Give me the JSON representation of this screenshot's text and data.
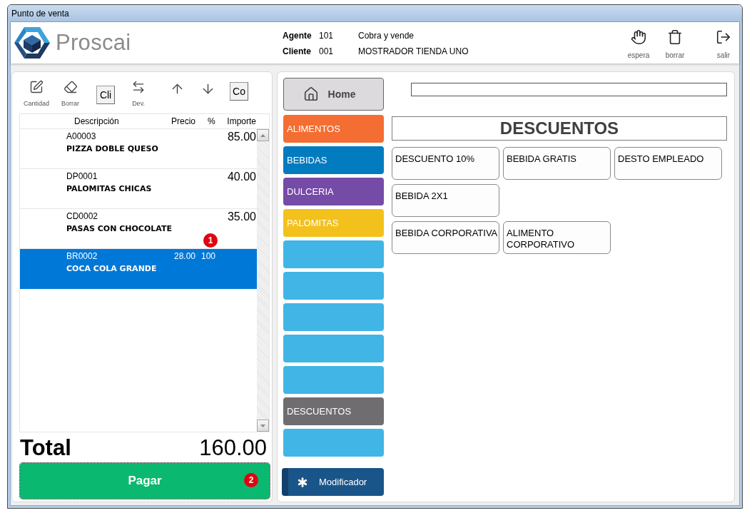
{
  "window": {
    "title": "Punto de venta"
  },
  "logo": {
    "text": "Proscai"
  },
  "session": [
    {
      "label": "Agente",
      "code": "101",
      "value": "Cobra y vende"
    },
    {
      "label": "Cliente",
      "code": "001",
      "value": "MOSTRADOR TIENDA UNO"
    }
  ],
  "header_actions": [
    {
      "label": "espera"
    },
    {
      "label": "borrar"
    },
    {
      "label": "salir"
    }
  ],
  "toolbar": [
    {
      "kind": "icon",
      "label": "Cantidad"
    },
    {
      "kind": "icon",
      "label": "Borrar"
    },
    {
      "kind": "button",
      "label": "Cli"
    },
    {
      "kind": "icon",
      "label": "Dev."
    },
    {
      "kind": "icon"
    },
    {
      "kind": "icon"
    },
    {
      "kind": "button",
      "label": "Co"
    }
  ],
  "table": {
    "columns": [
      "Descripción",
      "Precio",
      "%",
      "Importe"
    ],
    "callout": "1",
    "rows": [
      {
        "code": "A00003",
        "name": "PIZZA DOBLE QUESO",
        "amount": "85.00",
        "selected": false
      },
      {
        "code": "DP0001",
        "name": "PALOMITAS CHICAS",
        "amount": "40.00",
        "selected": false
      },
      {
        "code": "CD0002",
        "name": "PASAS CON CHOCOLATE",
        "amount": "35.00",
        "selected": false
      },
      {
        "code": "BR0002",
        "name": "COCA COLA GRANDE",
        "price": "28.00",
        "discount": "100",
        "selected": true
      }
    ]
  },
  "total": {
    "label": "Total",
    "value": "160.00"
  },
  "pay_button": {
    "label": "Pagar",
    "callout": "2"
  },
  "home_button": {
    "label": "Home"
  },
  "categories": [
    {
      "label": "ALIMENTOS",
      "color": "#f46d32"
    },
    {
      "label": "BEBIDAS",
      "color": "#027bbf"
    },
    {
      "label": "DULCERIA",
      "color": "#764ba8"
    },
    {
      "label": "PALOMITAS",
      "color": "#f3c11c"
    },
    {
      "color": "#41b5e6"
    },
    {
      "color": "#41b5e6"
    },
    {
      "color": "#41b5e6"
    },
    {
      "color": "#41b5e6"
    },
    {
      "color": "#41b5e6"
    },
    {
      "label": "DESCUENTOS",
      "color": "#706d70"
    },
    {
      "color": "#41b5e6"
    }
  ],
  "modifier_button": {
    "label": "Modificador"
  },
  "section": {
    "title": "DESCUENTOS",
    "rows": [
      [
        "DESCUENTO 10%",
        "BEBIDA GRATIS",
        "DESTO EMPLEADO"
      ],
      [
        "BEBIDA 2X1"
      ],
      [
        "BEBIDA CORPORATIVA",
        "ALIMENTO CORPORATIVO"
      ]
    ]
  }
}
